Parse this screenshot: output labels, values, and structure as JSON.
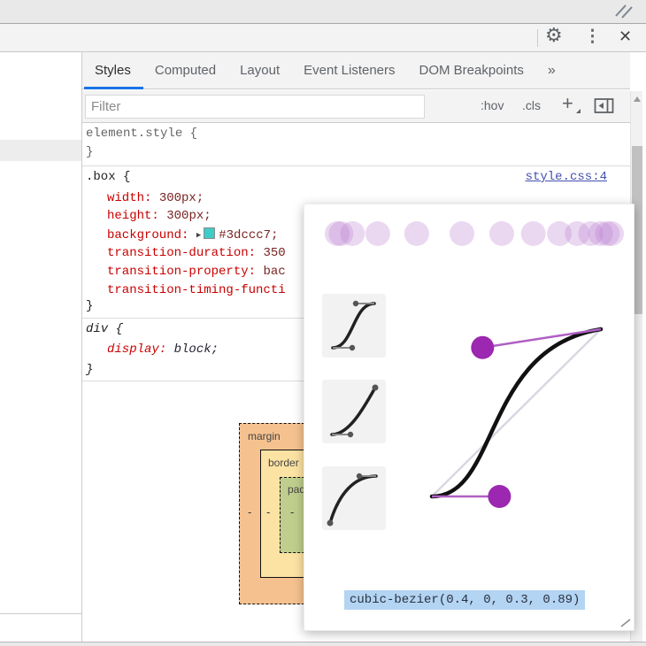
{
  "titlebar": {
    "resize_icon": "resize-handle"
  },
  "toolbar": {
    "gear_glyph": "⚙",
    "more_glyph": "⋮",
    "close_glyph": "✕"
  },
  "tabs": {
    "active": "Styles",
    "items": [
      {
        "label": "Styles"
      },
      {
        "label": "Computed"
      },
      {
        "label": "Layout"
      },
      {
        "label": "Event Listeners"
      },
      {
        "label": "DOM Breakpoints"
      }
    ],
    "overflow_glyph": "»"
  },
  "filter_bar": {
    "placeholder": "Filter",
    "hov": ":hov",
    "cls": ".cls",
    "plus": "+"
  },
  "styles_pane": {
    "punct": {
      "colon": ": ",
      "semi": ";",
      "close": "}"
    },
    "element_style": {
      "selector": "element.style {"
    },
    "box_rule": {
      "selector": ".box {",
      "source_link": "style.css:4",
      "props": [
        {
          "name": "width",
          "value": "300px"
        },
        {
          "name": "height",
          "value": "300px"
        },
        {
          "name": "background",
          "value": "#3dccc7",
          "disclosure": "▶"
        },
        {
          "name": "transition-duration",
          "value": "350"
        },
        {
          "name": "transition-property",
          "value": "bac"
        },
        {
          "name": "transition-timing-functi",
          "value": ""
        }
      ]
    },
    "div_rule": {
      "selector": "div {",
      "props": [
        {
          "name": "display",
          "value": "block"
        }
      ]
    }
  },
  "box_model": {
    "margin_label": "margin",
    "border_label": "border",
    "padding_label": "pad",
    "dash": "-"
  },
  "bezier_popup": {
    "value": "cubic-bezier(0.4, 0, 0.3, 0.89)",
    "x1": 0.4,
    "y1": 0,
    "x2": 0.3,
    "y2": 0.89,
    "preview_dots": [
      0,
      0.014,
      0.056,
      0.148,
      0.29,
      0.455,
      0.6,
      0.715,
      0.81,
      0.875,
      0.924,
      0.96,
      0.985,
      1
    ],
    "presets": [
      "ease-in-out",
      "ease-in",
      "ease-out"
    ]
  },
  "colors": {
    "accent": "#1a73e8",
    "swatch": "#3dccc7",
    "prop_name": "#c80000",
    "prop_value": "#7a2222",
    "link": "#4350af",
    "selection": "#b3d4f2",
    "bezier_control": "#9c27b0",
    "bezier_handle": "#b05fc4",
    "bezier_dot": "#b87fd0",
    "margin_fill": "#f5c28f",
    "border_fill": "#fde3a3",
    "padding_fill": "#c0ce8d"
  }
}
